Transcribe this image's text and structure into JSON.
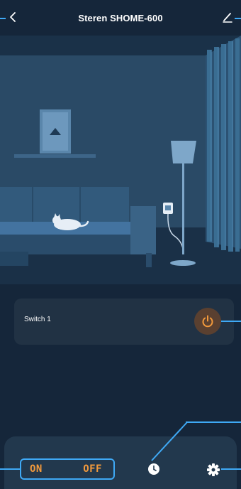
{
  "header": {
    "title": "Steren SHOME-600",
    "back_icon": "chevron-left-icon",
    "edit_icon": "pencil-icon"
  },
  "switches": [
    {
      "label": "Switch 1",
      "icon": "power-icon",
      "accent": "#f39a3c"
    }
  ],
  "bottom_bar": {
    "on_label": "ON",
    "off_label": "OFF",
    "timer_icon": "clock-icon",
    "settings_icon": "gear-icon"
  },
  "colors": {
    "accent_orange": "#f39a3c",
    "highlight_blue": "#3fa9f5",
    "background": "#15263a",
    "card": "#213244"
  }
}
